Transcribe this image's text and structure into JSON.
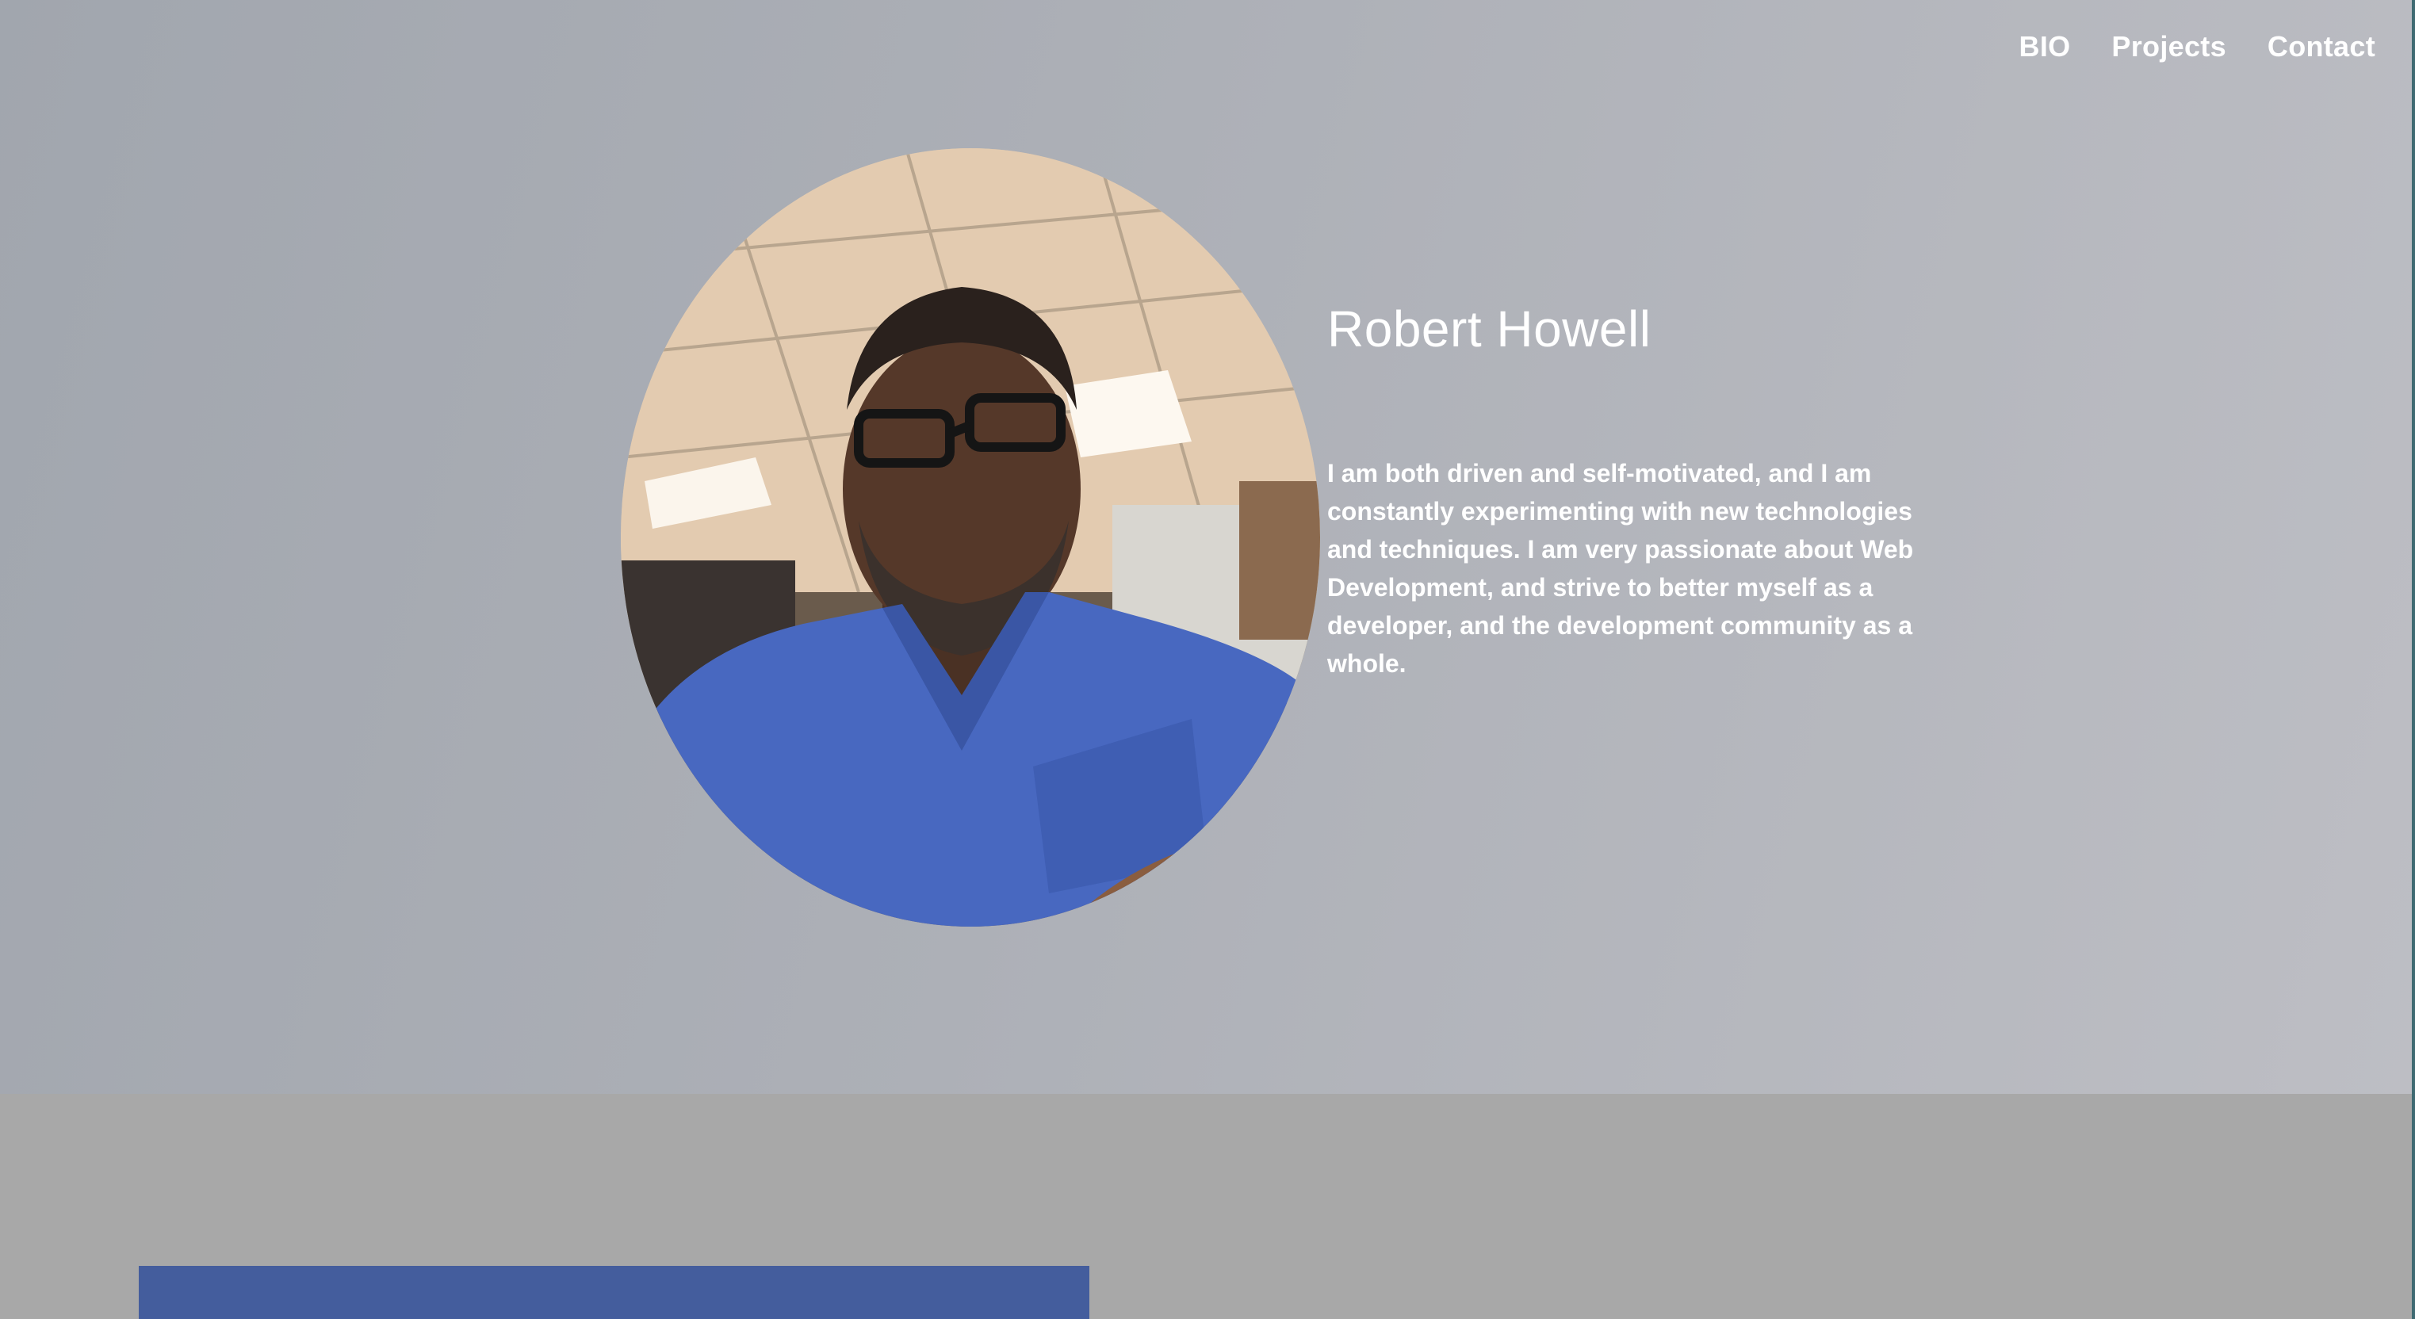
{
  "nav": {
    "items": [
      "BIO",
      "Projects",
      "Contact"
    ]
  },
  "profile": {
    "name": "Robert Howell",
    "bio": "I am both driven and self-motivated, and I am constantly experimenting with new technologies and techniques. I am very passionate about Web Development, and strive to better myself as a developer, and the development community as a whole."
  },
  "colors": {
    "hero_gradient_start": "#a1a6ae",
    "hero_gradient_end": "#bdbec4",
    "section_background": "#a8a8a8",
    "project_card": "#445d9d",
    "text": "#ffffff"
  }
}
